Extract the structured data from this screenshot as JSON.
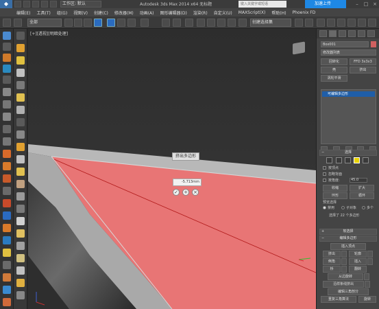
{
  "titlebar": {
    "app_icon": "3ds-max-logo",
    "workspace": "工作区: 默认",
    "title": "Autodesk 3ds Max  2014 x64     无标题",
    "search_placeholder": "键入关键字或短语",
    "cloud_button": "加速上传"
  },
  "menu": [
    "编辑(E)",
    "工具(T)",
    "组(G)",
    "视图(V)",
    "创建(C)",
    "修改器(M)",
    "动画(A)",
    "图形编辑器(D)",
    "渲染(R)",
    "自定义(U)",
    "MAXScript(X)",
    "帮助(H)",
    "Phoenix FD"
  ],
  "toolbar": {
    "selection_filter": "全部",
    "named_selection": "创建选择集"
  },
  "viewport": {
    "label": "[+][透视][明暗处理]",
    "tooltip_title": "挤出多边形",
    "extrude_value": "-5.713mm"
  },
  "panel": {
    "object_name": "Box001",
    "modifier_list": "修改器列表",
    "buttons": {
      "fallback": "回转化",
      "ffd": "FFD 3x3x3",
      "shell": "壳",
      "extrude": "挤出",
      "meshsmooth": "涡轮平滑"
    },
    "stack_item": "可编辑多边形",
    "selection": {
      "title": "选择",
      "by_vertex": "按顶点",
      "ignore_backfacing": "忽略背面",
      "by_angle": "按角度:",
      "angle_value": "45.0",
      "shrink": "收缩",
      "grow": "扩大",
      "ring": "环形",
      "loop": "循环",
      "preview": "预览选择",
      "disabled": "禁用",
      "subobject": "子对象",
      "multi": "多个",
      "status": "选择了 22 个多边形"
    },
    "soft_selection": {
      "title": "软选择"
    },
    "edit_polygons": {
      "title": "编辑多边形",
      "insert_vertex": "插入顶点",
      "extrude": "挤出",
      "outline": "轮廓",
      "bevel": "倒角",
      "inset": "插入",
      "bridge": "桥",
      "flip": "翻转",
      "hinge": "从边旋转",
      "extrude_along_spline": "沿样条线挤出",
      "edit_triangulation": "编辑三角剖分",
      "retriangulate": "重复三角算法",
      "turn": "旋转"
    }
  },
  "colors": {
    "selected_face": "#e87575",
    "edge_line": "#b01818",
    "accent": "#1e88e5",
    "viewport_bg": "#2d2d2d"
  }
}
